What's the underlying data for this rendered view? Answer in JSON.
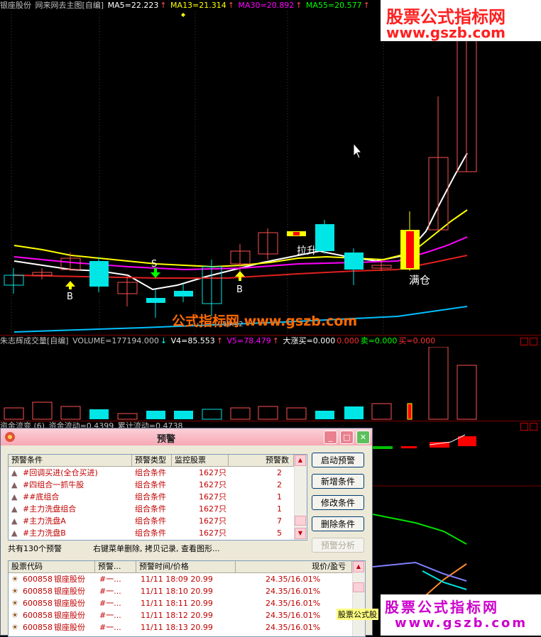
{
  "main_header": {
    "stock": "银座股份",
    "indicator": "网来网去主图[自编]",
    "ma5": "MA5=22.223",
    "ma13": "MA13=21.314",
    "ma30": "MA30=20.892",
    "ma55": "MA55=20.577"
  },
  "chart_labels": {
    "buy1": "B",
    "sell": "S",
    "buy2": "B",
    "lasheng": "拉升",
    "mancang": "满仓",
    "price_low": "19.42"
  },
  "volume_header": {
    "indicator": "朱志辉成交量[自编]",
    "volume": "VOLUME=177194.000",
    "v4": "V4=85.553",
    "v5": "V5=78.479",
    "dazhang": "大涨买=0.000",
    "v_red": "0.000",
    "mai_green": "卖=0.000",
    "mai_red": "买=0.000"
  },
  "third_header": {
    "left": "资金流变 (6)",
    "mid": "资金流动=0.4399",
    "right": "累计流动=0.4738"
  },
  "watermarks": {
    "top_cn": "股票公式指标网",
    "top_url": "www.gszb.com",
    "mid": "公式指标网",
    "mid_url": "www.gszb.com",
    "bot_cn": "股票公式指标网",
    "bot_url": "www.gszb.com",
    "bot_tag": "股票公式股"
  },
  "dialog": {
    "title": "预警",
    "min": "_",
    "max": "□",
    "close": "✕",
    "top_table": {
      "headers": [
        "预警条件",
        "预警类型",
        "监控股票",
        "预警数"
      ],
      "rows": [
        {
          "name": "#回调买进(全仓买进)",
          "type": "组合条件",
          "count": "1627只",
          "alerts": "2"
        },
        {
          "name": "#四组合一抓牛股",
          "type": "组合条件",
          "count": "1627只",
          "alerts": "2"
        },
        {
          "name": "##底组合",
          "type": "组合条件",
          "count": "1627只",
          "alerts": "1"
        },
        {
          "name": "#主力洗盘组合",
          "type": "组合条件",
          "count": "1627只",
          "alerts": "1"
        },
        {
          "name": "#主力洗盘A",
          "type": "组合条件",
          "count": "1627只",
          "alerts": "7"
        },
        {
          "name": "#主力洗盘B",
          "type": "组合条件",
          "count": "1627只",
          "alerts": "5"
        }
      ]
    },
    "buttons": [
      "启动预警",
      "新增条件",
      "修改条件",
      "删除条件",
      "预警分析"
    ],
    "status_left": "共有130个预警",
    "status_right": "右键菜单删除, 拷贝记录, 查看图形...",
    "bottom_table": {
      "headers": [
        "股票代码",
        "预警...",
        "预警时间/价格",
        "现价/盈亏"
      ],
      "rows": [
        {
          "code": "600858",
          "name": "银座股份",
          "cond": "#一...",
          "time": "11/11 18:09 20.99",
          "result": "24.35/16.01%"
        },
        {
          "code": "600858",
          "name": "银座股份",
          "cond": "#一...",
          "time": "11/11 18:10 20.99",
          "result": "24.35/16.01%"
        },
        {
          "code": "600858",
          "name": "银座股份",
          "cond": "#一...",
          "time": "11/11 18:11 20.99",
          "result": "24.35/16.01%"
        },
        {
          "code": "600858",
          "name": "银座股份",
          "cond": "#一...",
          "time": "11/11 18:12 20.99",
          "result": "24.35/16.01%"
        },
        {
          "code": "600858",
          "name": "银座股份",
          "cond": "#一...",
          "time": "11/11 18:13 20.99",
          "result": "24.35/16.01%"
        }
      ]
    }
  },
  "colors": {
    "up": "#ff3030",
    "down": "#00e5e5",
    "ma5": "#ffffff",
    "ma13": "#ffff00",
    "ma30": "#ff00ff",
    "ma55": "#ff3030",
    "alert_red": "#c00000"
  }
}
